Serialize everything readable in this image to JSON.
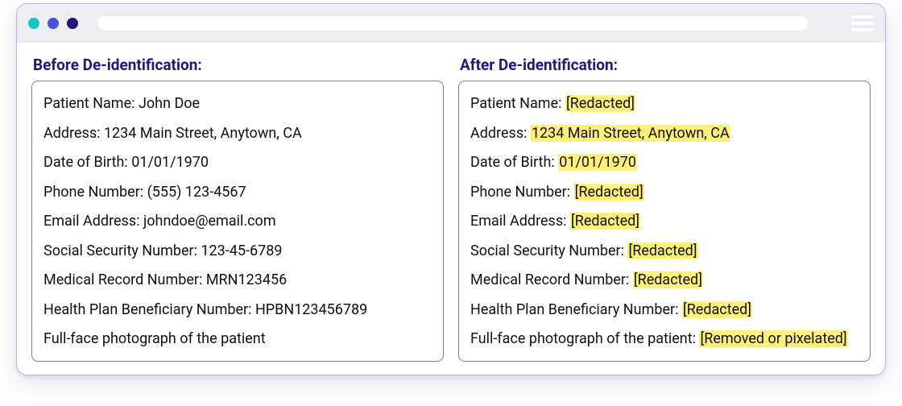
{
  "titlebar": {
    "dots": [
      "teal",
      "indigo",
      "navy"
    ]
  },
  "before": {
    "title": "Before De-identification:",
    "rows": [
      {
        "label": "Patient Name: ",
        "value": "John Doe",
        "hl": false
      },
      {
        "label": "Address: ",
        "value": "1234 Main Street, Anytown, CA",
        "hl": false
      },
      {
        "label": "Date of Birth: ",
        "value": "01/01/1970",
        "hl": false
      },
      {
        "label": "Phone Number: ",
        "value": "(555) 123-4567",
        "hl": false
      },
      {
        "label": "Email Address: ",
        "value": "johndoe@email.com",
        "hl": false
      },
      {
        "label": "Social Security Number: ",
        "value": "123-45-6789",
        "hl": false
      },
      {
        "label": "Medical Record Number: ",
        "value": "MRN123456",
        "hl": false
      },
      {
        "label": "Health Plan Beneficiary Number: ",
        "value": "HPBN123456789",
        "hl": false
      },
      {
        "label": "Full-face photograph of the patient",
        "value": "",
        "hl": false
      }
    ]
  },
  "after": {
    "title": "After De-identification:",
    "rows": [
      {
        "label": "Patient Name: ",
        "value": "[Redacted]",
        "hl": true
      },
      {
        "label": "Address: ",
        "value": "1234 Main Street, Anytown, CA",
        "hl": true
      },
      {
        "label": "Date of Birth: ",
        "value": "01/01/1970",
        "hl": true
      },
      {
        "label": "Phone Number: ",
        "value": "[Redacted]",
        "hl": true
      },
      {
        "label": "Email Address: ",
        "value": "[Redacted]",
        "hl": true
      },
      {
        "label": "Social Security Number: ",
        "value": "[Redacted]",
        "hl": true
      },
      {
        "label": "Medical Record Number: ",
        "value": "[Redacted]",
        "hl": true
      },
      {
        "label": "Health Plan Beneficiary Number: ",
        "value": "[Redacted]",
        "hl": true
      },
      {
        "label": "Full-face photograph of the patient: ",
        "value": "[Removed or pixelated]",
        "hl": true
      }
    ]
  }
}
